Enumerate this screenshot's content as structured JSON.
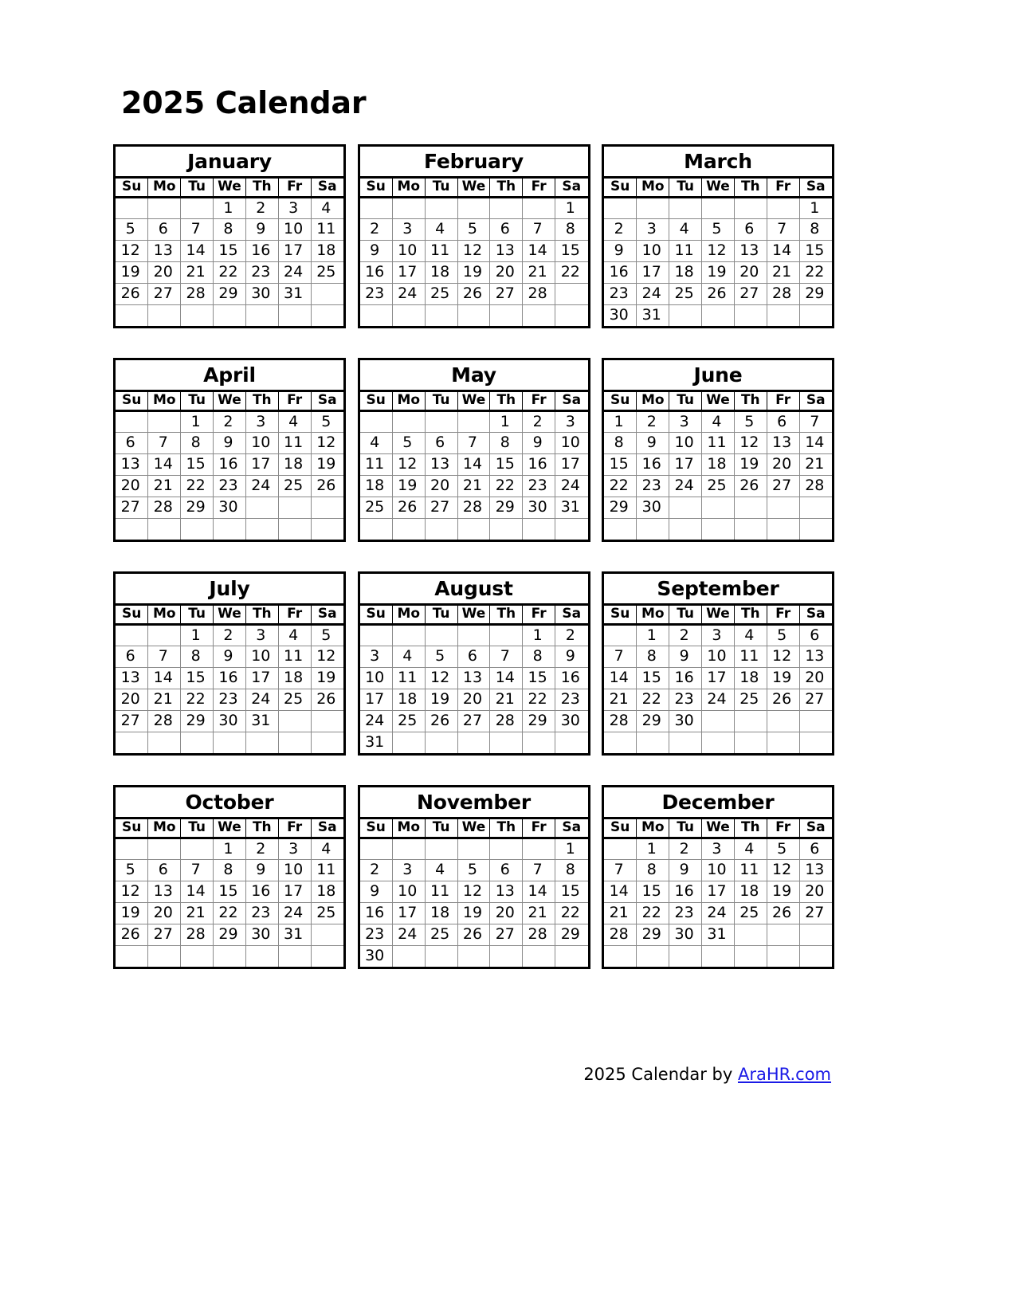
{
  "title": "2025 Calendar",
  "year": "2025",
  "weekday_headers": [
    "Su",
    "Mo",
    "Tu",
    "We",
    "Th",
    "Fr",
    "Sa"
  ],
  "footer": {
    "prefix": "2025  Calendar by ",
    "link_text": "AraHR.com",
    "link_color": "#1a1ae6"
  },
  "colors": {
    "text": "#000000",
    "border_outer": "#000000",
    "border_inner": "#8a8a8a",
    "background": "#ffffff",
    "link": "#1a1ae6"
  },
  "chart_data": {
    "type": "table",
    "title": "2025 Calendar",
    "columns": [
      "Su",
      "Mo",
      "Tu",
      "We",
      "Th",
      "Fr",
      "Sa"
    ],
    "months": [
      {
        "name": "January",
        "days_in_month": 31,
        "first_weekday_index": 3,
        "weeks": [
          [
            "",
            "",
            "",
            "1",
            "2",
            "3",
            "4"
          ],
          [
            "5",
            "6",
            "7",
            "8",
            "9",
            "10",
            "11"
          ],
          [
            "12",
            "13",
            "14",
            "15",
            "16",
            "17",
            "18"
          ],
          [
            "19",
            "20",
            "21",
            "22",
            "23",
            "24",
            "25"
          ],
          [
            "26",
            "27",
            "28",
            "29",
            "30",
            "31",
            ""
          ],
          [
            "",
            "",
            "",
            "",
            "",
            "",
            ""
          ]
        ]
      },
      {
        "name": "February",
        "days_in_month": 28,
        "first_weekday_index": 6,
        "weeks": [
          [
            "",
            "",
            "",
            "",
            "",
            "",
            "1"
          ],
          [
            "2",
            "3",
            "4",
            "5",
            "6",
            "7",
            "8"
          ],
          [
            "9",
            "10",
            "11",
            "12",
            "13",
            "14",
            "15"
          ],
          [
            "16",
            "17",
            "18",
            "19",
            "20",
            "21",
            "22"
          ],
          [
            "23",
            "24",
            "25",
            "26",
            "27",
            "28",
            ""
          ],
          [
            "",
            "",
            "",
            "",
            "",
            "",
            ""
          ]
        ]
      },
      {
        "name": "March",
        "days_in_month": 31,
        "first_weekday_index": 6,
        "weeks": [
          [
            "",
            "",
            "",
            "",
            "",
            "",
            "1"
          ],
          [
            "2",
            "3",
            "4",
            "5",
            "6",
            "7",
            "8"
          ],
          [
            "9",
            "10",
            "11",
            "12",
            "13",
            "14",
            "15"
          ],
          [
            "16",
            "17",
            "18",
            "19",
            "20",
            "21",
            "22"
          ],
          [
            "23",
            "24",
            "25",
            "26",
            "27",
            "28",
            "29"
          ],
          [
            "30",
            "31",
            "",
            "",
            "",
            "",
            ""
          ]
        ]
      },
      {
        "name": "April",
        "days_in_month": 30,
        "first_weekday_index": 2,
        "weeks": [
          [
            "",
            "",
            "1",
            "2",
            "3",
            "4",
            "5"
          ],
          [
            "6",
            "7",
            "8",
            "9",
            "10",
            "11",
            "12"
          ],
          [
            "13",
            "14",
            "15",
            "16",
            "17",
            "18",
            "19"
          ],
          [
            "20",
            "21",
            "22",
            "23",
            "24",
            "25",
            "26"
          ],
          [
            "27",
            "28",
            "29",
            "30",
            "",
            "",
            ""
          ],
          [
            "",
            "",
            "",
            "",
            "",
            "",
            ""
          ]
        ]
      },
      {
        "name": "May",
        "days_in_month": 31,
        "first_weekday_index": 4,
        "weeks": [
          [
            "",
            "",
            "",
            "",
            "1",
            "2",
            "3"
          ],
          [
            "4",
            "5",
            "6",
            "7",
            "8",
            "9",
            "10"
          ],
          [
            "11",
            "12",
            "13",
            "14",
            "15",
            "16",
            "17"
          ],
          [
            "18",
            "19",
            "20",
            "21",
            "22",
            "23",
            "24"
          ],
          [
            "25",
            "26",
            "27",
            "28",
            "29",
            "30",
            "31"
          ],
          [
            "",
            "",
            "",
            "",
            "",
            "",
            ""
          ]
        ]
      },
      {
        "name": "June",
        "days_in_month": 30,
        "first_weekday_index": 0,
        "weeks": [
          [
            "1",
            "2",
            "3",
            "4",
            "5",
            "6",
            "7"
          ],
          [
            "8",
            "9",
            "10",
            "11",
            "12",
            "13",
            "14"
          ],
          [
            "15",
            "16",
            "17",
            "18",
            "19",
            "20",
            "21"
          ],
          [
            "22",
            "23",
            "24",
            "25",
            "26",
            "27",
            "28"
          ],
          [
            "29",
            "30",
            "",
            "",
            "",
            "",
            ""
          ],
          [
            "",
            "",
            "",
            "",
            "",
            "",
            ""
          ]
        ]
      },
      {
        "name": "July",
        "days_in_month": 31,
        "first_weekday_index": 2,
        "weeks": [
          [
            "",
            "",
            "1",
            "2",
            "3",
            "4",
            "5"
          ],
          [
            "6",
            "7",
            "8",
            "9",
            "10",
            "11",
            "12"
          ],
          [
            "13",
            "14",
            "15",
            "16",
            "17",
            "18",
            "19"
          ],
          [
            "20",
            "21",
            "22",
            "23",
            "24",
            "25",
            "26"
          ],
          [
            "27",
            "28",
            "29",
            "30",
            "31",
            "",
            ""
          ],
          [
            "",
            "",
            "",
            "",
            "",
            "",
            ""
          ]
        ]
      },
      {
        "name": "August",
        "days_in_month": 31,
        "first_weekday_index": 5,
        "weeks": [
          [
            "",
            "",
            "",
            "",
            "",
            "1",
            "2"
          ],
          [
            "3",
            "4",
            "5",
            "6",
            "7",
            "8",
            "9"
          ],
          [
            "10",
            "11",
            "12",
            "13",
            "14",
            "15",
            "16"
          ],
          [
            "17",
            "18",
            "19",
            "20",
            "21",
            "22",
            "23"
          ],
          [
            "24",
            "25",
            "26",
            "27",
            "28",
            "29",
            "30"
          ],
          [
            "31",
            "",
            "",
            "",
            "",
            "",
            ""
          ]
        ]
      },
      {
        "name": "September",
        "days_in_month": 30,
        "first_weekday_index": 1,
        "weeks": [
          [
            "",
            "1",
            "2",
            "3",
            "4",
            "5",
            "6"
          ],
          [
            "7",
            "8",
            "9",
            "10",
            "11",
            "12",
            "13"
          ],
          [
            "14",
            "15",
            "16",
            "17",
            "18",
            "19",
            "20"
          ],
          [
            "21",
            "22",
            "23",
            "24",
            "25",
            "26",
            "27"
          ],
          [
            "28",
            "29",
            "30",
            "",
            "",
            "",
            ""
          ],
          [
            "",
            "",
            "",
            "",
            "",
            "",
            ""
          ]
        ]
      },
      {
        "name": "October",
        "days_in_month": 31,
        "first_weekday_index": 3,
        "weeks": [
          [
            "",
            "",
            "",
            "1",
            "2",
            "3",
            "4"
          ],
          [
            "5",
            "6",
            "7",
            "8",
            "9",
            "10",
            "11"
          ],
          [
            "12",
            "13",
            "14",
            "15",
            "16",
            "17",
            "18"
          ],
          [
            "19",
            "20",
            "21",
            "22",
            "23",
            "24",
            "25"
          ],
          [
            "26",
            "27",
            "28",
            "29",
            "30",
            "31",
            ""
          ],
          [
            "",
            "",
            "",
            "",
            "",
            "",
            ""
          ]
        ]
      },
      {
        "name": "November",
        "days_in_month": 30,
        "first_weekday_index": 6,
        "weeks": [
          [
            "",
            "",
            "",
            "",
            "",
            "",
            "1"
          ],
          [
            "2",
            "3",
            "4",
            "5",
            "6",
            "7",
            "8"
          ],
          [
            "9",
            "10",
            "11",
            "12",
            "13",
            "14",
            "15"
          ],
          [
            "16",
            "17",
            "18",
            "19",
            "20",
            "21",
            "22"
          ],
          [
            "23",
            "24",
            "25",
            "26",
            "27",
            "28",
            "29"
          ],
          [
            "30",
            "",
            "",
            "",
            "",
            "",
            ""
          ]
        ]
      },
      {
        "name": "December",
        "days_in_month": 31,
        "first_weekday_index": 1,
        "weeks": [
          [
            "",
            "1",
            "2",
            "3",
            "4",
            "5",
            "6"
          ],
          [
            "7",
            "8",
            "9",
            "10",
            "11",
            "12",
            "13"
          ],
          [
            "14",
            "15",
            "16",
            "17",
            "18",
            "19",
            "20"
          ],
          [
            "21",
            "22",
            "23",
            "24",
            "25",
            "26",
            "27"
          ],
          [
            "28",
            "29",
            "30",
            "31",
            "",
            "",
            ""
          ],
          [
            "",
            "",
            "",
            "",
            "",
            "",
            ""
          ]
        ]
      }
    ]
  }
}
